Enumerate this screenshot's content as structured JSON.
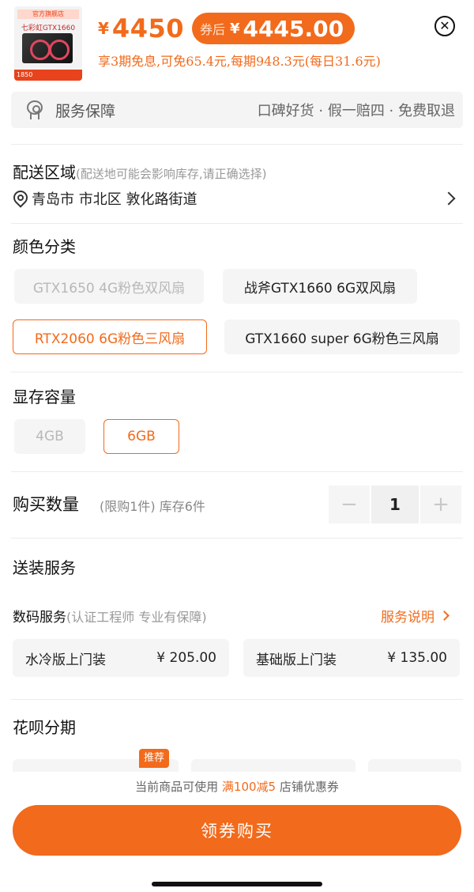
{
  "header": {
    "thumb_tag": "官方旗舰店",
    "thumb_name": "七彩虹GTX1660",
    "thumb_foot": "1850",
    "price_symbol": "¥",
    "price": "4450",
    "coupon_label": "券后",
    "coupon_symbol": "¥",
    "coupon_price": "4445.00",
    "installment_note": "享3期免息,可免65.4元,每期948.3元(每日31.6元)",
    "close_icon": "close-circle-icon"
  },
  "service": {
    "icon": "medal-icon",
    "title": "服务保障",
    "tags": "口碑好货 · 假一赔四 · 免费取退"
  },
  "delivery": {
    "title": "配送区域",
    "note": "(配送地可能会影响库存,请正确选择)",
    "address": "青岛市 市北区 敦化路街道",
    "pin_icon": "location-pin-icon",
    "chevron_icon": "chevron-right-icon"
  },
  "color": {
    "title": "颜色分类",
    "options": [
      {
        "label": "GTX1650 4G粉色双风扇",
        "state": "disabled"
      },
      {
        "label": "战斧GTX1660 6G双风扇",
        "state": "normal"
      },
      {
        "label": "RTX2060 6G粉色三风扇",
        "state": "selected"
      },
      {
        "label": "GTX1660 super 6G粉色三风扇",
        "state": "normal"
      }
    ]
  },
  "memory": {
    "title": "显存容量",
    "options": [
      {
        "label": "4GB",
        "state": "disabled"
      },
      {
        "label": "6GB",
        "state": "selected"
      }
    ]
  },
  "quantity": {
    "title": "购买数量",
    "note": "(限购1件) 库存6件",
    "minus": "−",
    "value": "1",
    "plus": "+"
  },
  "install": {
    "title": "送装服务",
    "digital_label": "数码服务",
    "digital_note": "(认证工程师 专业有保障)",
    "link_label": "服务说明",
    "cards": [
      {
        "name": "水冷版上门装",
        "price": "¥ 205.00"
      },
      {
        "name": "基础版上门装",
        "price": "¥ 135.00"
      }
    ]
  },
  "huabei": {
    "title": "花呗分期",
    "badge": "推荐"
  },
  "bottom": {
    "tip_prefix": "当前商品可使用",
    "tip_highlight": "满100减5",
    "tip_suffix": "店铺优惠券",
    "buy_label": "领券购买"
  },
  "colors": {
    "accent": "#f26a1b",
    "muted_bg": "#f5f5f5"
  }
}
